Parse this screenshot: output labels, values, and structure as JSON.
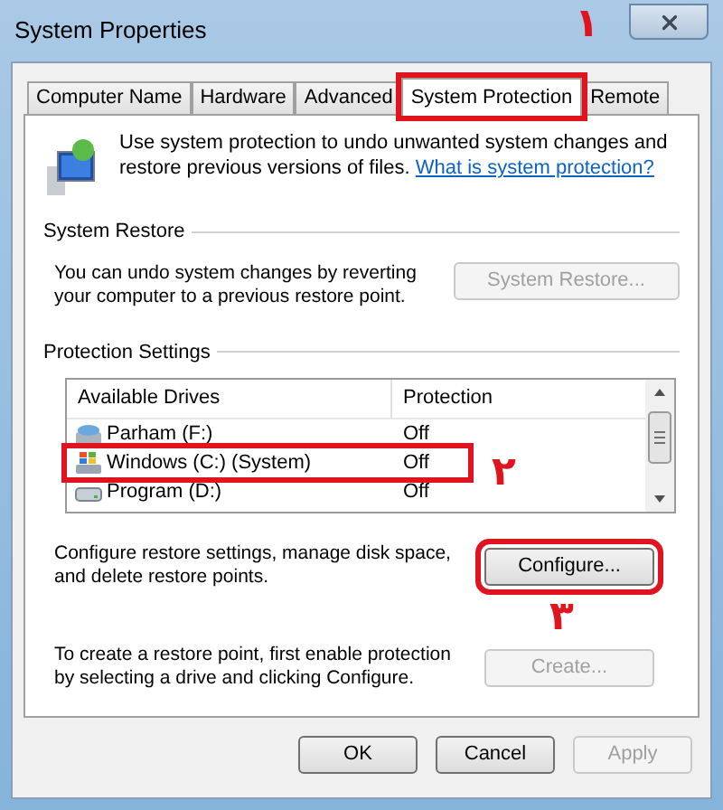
{
  "window": {
    "title": "System Properties"
  },
  "tabs": [
    {
      "label": "Computer Name",
      "selected": false,
      "highlighted": false
    },
    {
      "label": "Hardware",
      "selected": false,
      "highlighted": false
    },
    {
      "label": "Advanced",
      "selected": false,
      "highlighted": false
    },
    {
      "label": "System Protection",
      "selected": true,
      "highlighted": true
    },
    {
      "label": "Remote",
      "selected": false,
      "highlighted": false
    }
  ],
  "intro": {
    "text": "Use system protection to undo unwanted system changes and restore previous versions of files.",
    "link": "What is system protection?"
  },
  "system_restore": {
    "label": "System Restore",
    "description": "You can undo system changes by reverting your computer to a previous restore point.",
    "button": {
      "label": "System Restore...",
      "disabled": true
    }
  },
  "protection_settings": {
    "label": "Protection Settings",
    "columns": [
      "Available Drives",
      "Protection"
    ],
    "rows": [
      {
        "drive": "Parham (F:)",
        "kind": "drive",
        "protection": "Off",
        "highlighted": false
      },
      {
        "drive": "Windows (C:) (System)",
        "kind": "system",
        "protection": "Off",
        "highlighted": true
      },
      {
        "drive": "Program (D:)",
        "kind": "removable",
        "protection": "Off",
        "highlighted": false
      }
    ],
    "configure": {
      "description": "Configure restore settings, manage disk space, and delete restore points.",
      "button": {
        "label": "Configure...",
        "disabled": false,
        "highlighted": true
      }
    },
    "create": {
      "description": "To create a restore point, first enable protection by selecting a drive and clicking Configure.",
      "button": {
        "label": "Create...",
        "disabled": true
      }
    }
  },
  "footer_buttons": [
    {
      "label": "OK",
      "disabled": false
    },
    {
      "label": "Cancel",
      "disabled": false
    },
    {
      "label": "Apply",
      "disabled": true
    }
  ],
  "annotations": [
    "۱",
    "۲",
    "۳"
  ]
}
